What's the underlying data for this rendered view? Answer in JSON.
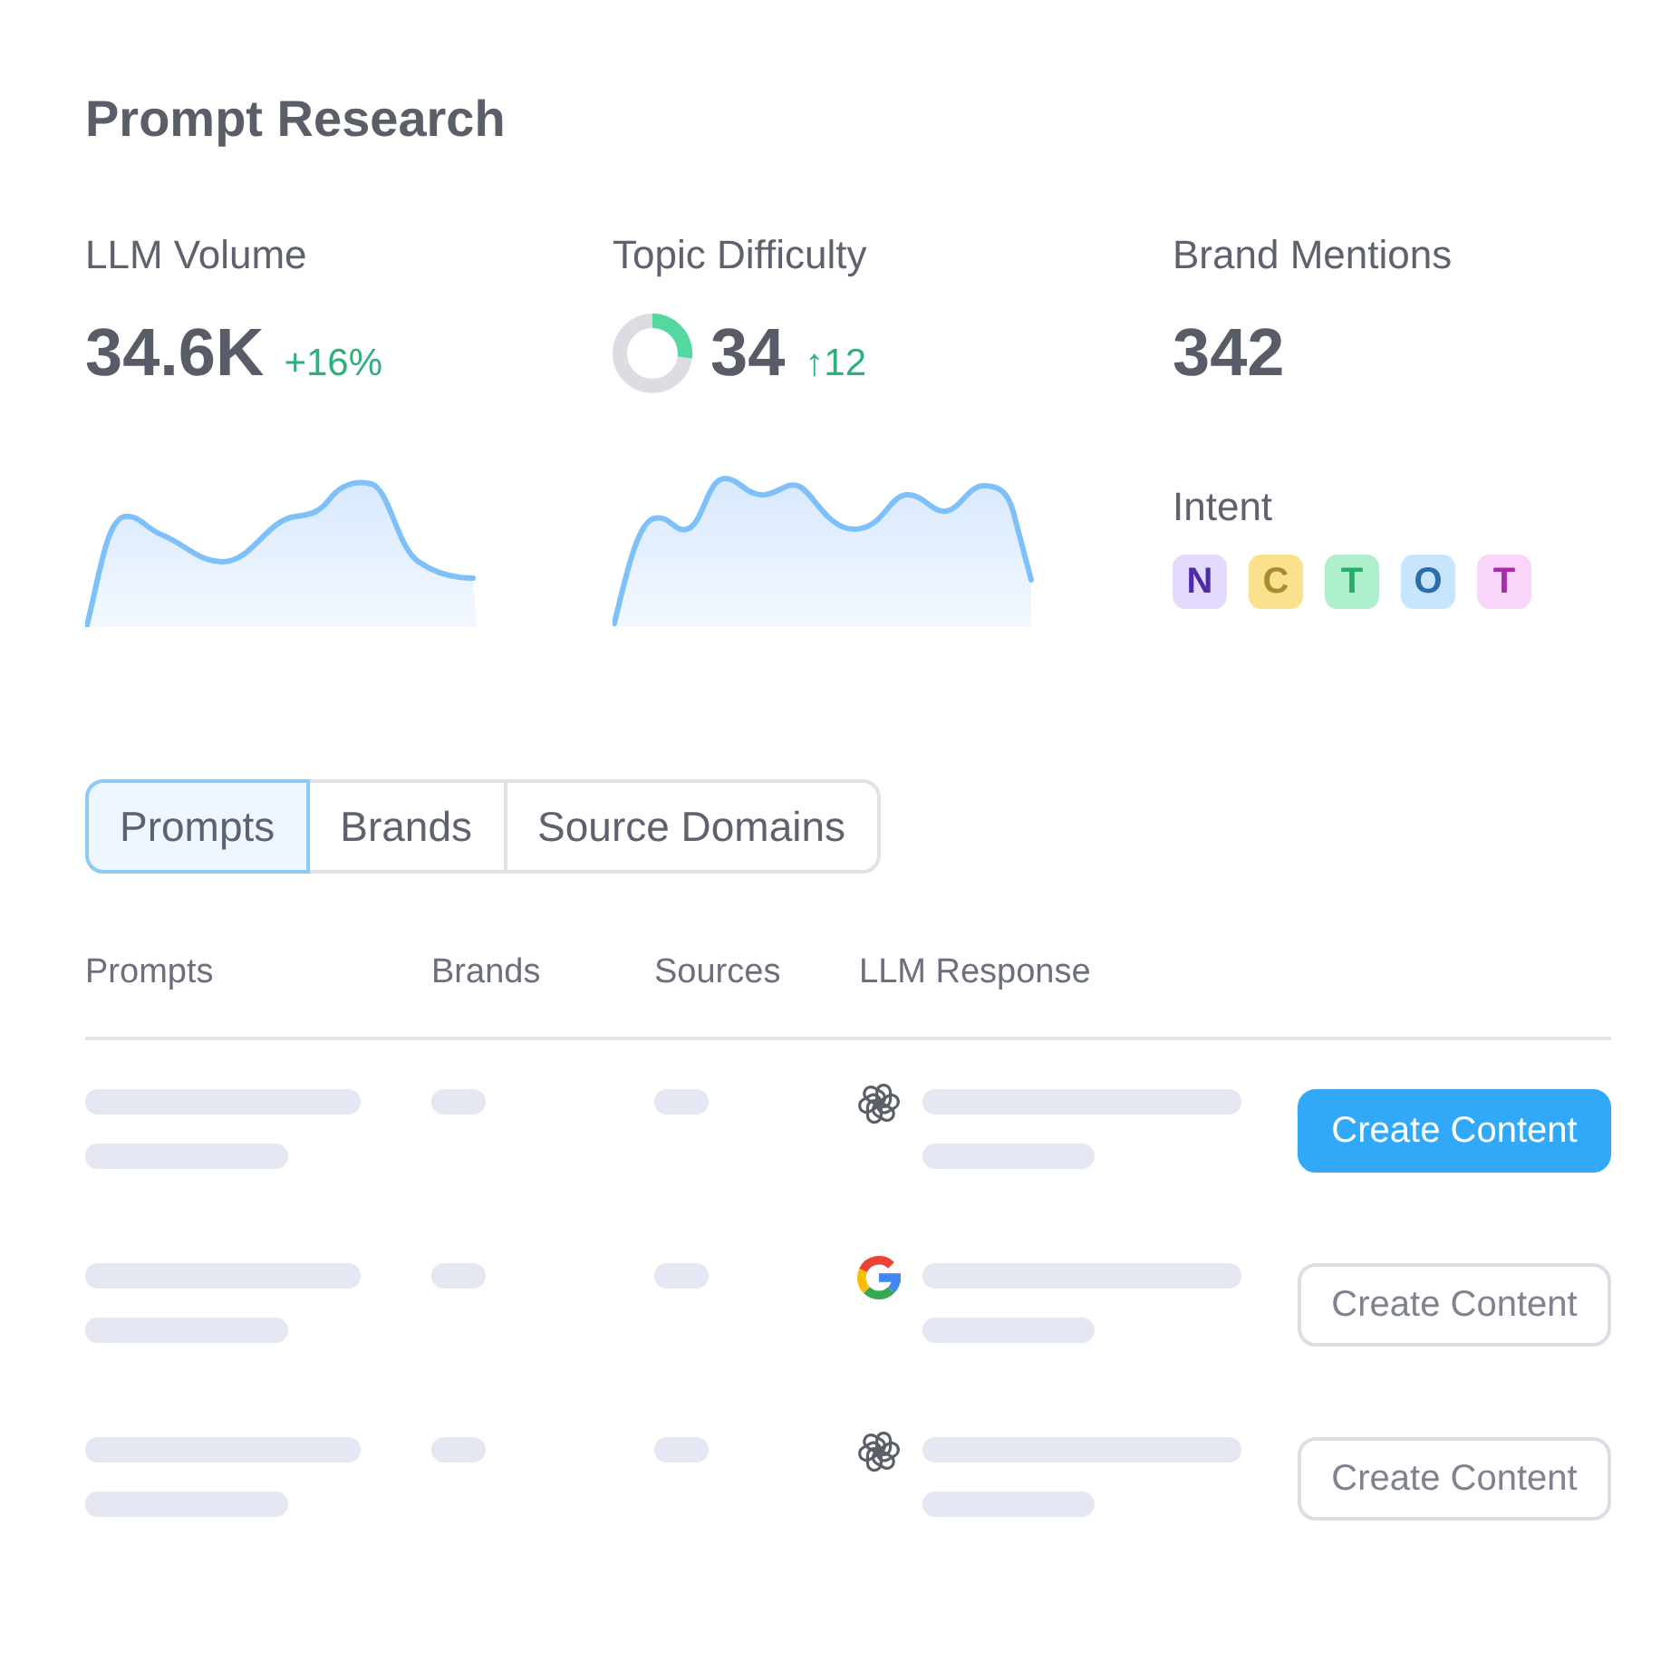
{
  "title": "Prompt Research",
  "metrics": [
    {
      "kind": "volume",
      "label": "LLM Volume",
      "value": "34.6K",
      "delta": "+16%"
    },
    {
      "kind": "difficulty",
      "label": "Topic Difficulty",
      "value": "34",
      "delta": "↑12",
      "level": 0.27
    },
    {
      "kind": "mentions",
      "label": "Brand Mentions",
      "value": "342",
      "intent": {
        "label": "Intent",
        "badges": [
          {
            "letter": "N",
            "color": "#e4dafd"
          },
          {
            "letter": "C",
            "color": "#fbe08e"
          },
          {
            "letter": "T",
            "color": "#aef0cd"
          },
          {
            "letter": "O",
            "color": "#c9e4fd"
          },
          {
            "letter": "T",
            "color": "#fad5fb"
          }
        ]
      }
    }
  ],
  "tabs": [
    {
      "label": "Prompts",
      "selected": true
    },
    {
      "label": "Brands",
      "selected": false
    },
    {
      "label": "Source Domains",
      "selected": false
    }
  ],
  "table": {
    "columns": [
      "Prompts",
      "Brands",
      "Sources",
      "LLM Response"
    ],
    "rows": [
      {
        "kind": "knot",
        "button": {
          "label": "Create Content",
          "highlighted": true
        }
      },
      {
        "kind": "letter",
        "button": {
          "label": "Create Content",
          "highlighted": false
        }
      },
      {
        "kind": "knot",
        "button": {
          "label": "Create Content",
          "highlighted": false
        }
      }
    ]
  }
}
